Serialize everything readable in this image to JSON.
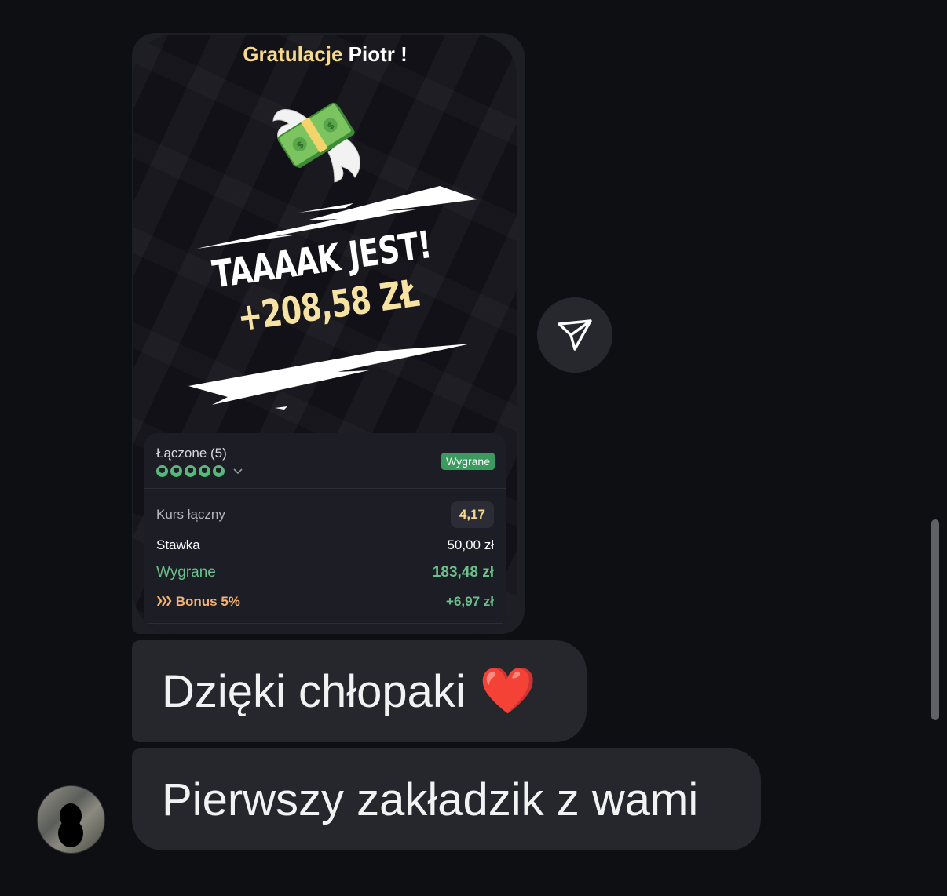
{
  "card": {
    "greeting_prefix": "Gratulacje",
    "greeting_name": "Piotr !",
    "headline": "TAAAAK JEST!",
    "amount": "+208,58 ZŁ",
    "bet": {
      "title": "Łączone (5)",
      "selections_count": 5,
      "status": "Wygrane",
      "odds_label": "Kurs łączny",
      "odds_value": "4,17",
      "stake_label": "Stawka",
      "stake_value": "50,00 zł",
      "win_label": "Wygrane",
      "win_value": "183,48 zł",
      "bonus_label": "Bonus 5%",
      "bonus_value": "+6,97 zł"
    }
  },
  "messages": [
    {
      "text": "Dzięki chłopaki",
      "emoji": "❤️"
    },
    {
      "text": "Pierwszy zakładzik z wami"
    }
  ],
  "colors": {
    "background": "#0d0f12",
    "bubble": "#25272c",
    "accent_gold": "#f6d98a",
    "win_green": "#6cc08a",
    "bonus_orange": "#f3b174"
  },
  "icons": {
    "share": "send-icon",
    "money": "money-with-wings-icon",
    "bonus": "chevrons-icon"
  }
}
